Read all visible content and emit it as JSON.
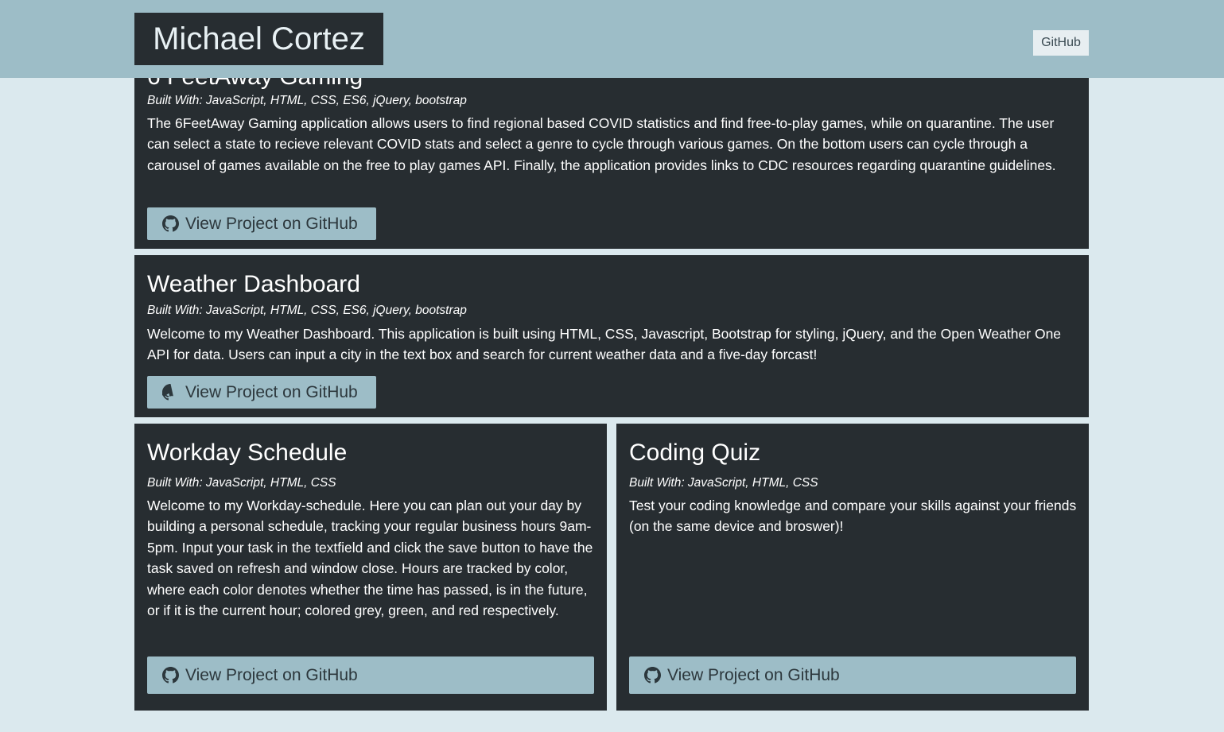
{
  "header": {
    "brand": "Michael Cortez",
    "nav_github": "GitHub"
  },
  "projects": [
    {
      "title": "6 FeetAway Gaming",
      "built_with": "Built With: JavaScript, HTML, CSS, ES6, jQuery, bootstrap",
      "description": "The 6FeetAway Gaming application allows users to find regional based COVID statistics and find free-to-play games, while on quarantine. The user can select a state to recieve relevant COVID stats and select a genre to cycle through various games. On the bottom users can cycle through a carousel of games available on the free to play games API. Finally, the application provides links to CDC resources regarding quarantine guidelines.",
      "button": "View Project on GitHub",
      "button_icon": "github-icon"
    },
    {
      "title": "Weather Dashboard",
      "built_with": "Built With: JavaScript, HTML, CSS, ES6, jQuery, bootstrap",
      "description": "Welcome to my Weather Dashboard. This application is built using HTML, CSS, Javascript, Bootstrap for styling, jQuery, and the Open Weather One API for data. Users can input a city in the text box and search for current weather data and a five-day forcast!",
      "button": "View Project on GitHub",
      "button_icon": "github-icon"
    },
    {
      "title": "Workday Schedule",
      "built_with": "Built With: JavaScript, HTML, CSS",
      "description": "Welcome to my Workday-schedule. Here you can plan out your day by building a personal schedule, tracking your regular business hours 9am-5pm. Input your task in the textfield and click the save button to have the task saved on refresh and window close. Hours are tracked by color, where each color denotes whether the time has passed, is in the future, or if it is the current hour; colored grey, green, and red respectively.",
      "button": "View Project on GitHub",
      "button_icon": "github-icon"
    },
    {
      "title": "Coding Quiz",
      "built_with": "Built With: JavaScript, HTML, CSS",
      "description": "Test your coding knowledge and compare your skills against your friends (on the same device and broswer)!",
      "button": "View Project on GitHub",
      "button_icon": "github-icon"
    }
  ],
  "colors": {
    "page_bg": "#dbe9ee",
    "header_bg": "#9dbdc7",
    "card_bg": "#272d31",
    "button_bg": "#9dbdc7"
  }
}
